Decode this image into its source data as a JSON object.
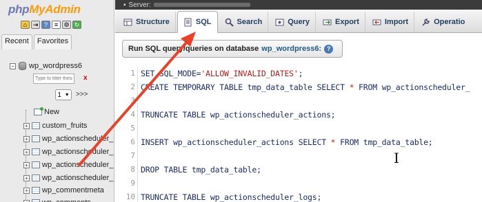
{
  "left_panel": {
    "logo_part1": "php",
    "logo_part2": "MyAdmin",
    "nav_tabs": [
      "Recent",
      "Favorites"
    ],
    "db_name": "wp_wordpress6",
    "filter_placeholder": "Type to filter these",
    "filter_clear": "x",
    "page_select_value": "1",
    "page_next": ">>>",
    "new_label": "New",
    "tables": [
      "custom_fruits",
      "wp_actionscheduler_",
      "wp_actionscheduler_",
      "wp_actionscheduler_",
      "wp_actionscheduler_",
      "wp_commentmeta",
      "wp_comments"
    ]
  },
  "server_bar": {
    "label": "Server:"
  },
  "tabs": [
    {
      "label": "Structure",
      "icon": "structure-icon"
    },
    {
      "label": "SQL",
      "icon": "sql-icon",
      "active": true
    },
    {
      "label": "Search",
      "icon": "search-icon"
    },
    {
      "label": "Query",
      "icon": "query-icon"
    },
    {
      "label": "Export",
      "icon": "export-icon"
    },
    {
      "label": "Import",
      "icon": "import-icon"
    },
    {
      "label": "Operatio",
      "icon": "wrench-icon"
    }
  ],
  "sql_panel": {
    "header_prefix": "Run SQL query/queries on database",
    "database": "wp_wordpress6:",
    "help_icon": "?"
  },
  "editor": {
    "lines": [
      {
        "n": "1",
        "text": "SET SQL_MODE=",
        "str": "'ALLOW_INVALID_DATES'",
        "tail": ";"
      },
      {
        "n": "2",
        "text": "CREATE TEMPORARY TABLE tmp_data_table SELECT ",
        "op": "*",
        "tail": " FROM wp_actionscheduler_"
      },
      {
        "n": "3",
        "text": ""
      },
      {
        "n": "4",
        "text": "TRUNCATE TABLE wp_actionscheduler_actions;"
      },
      {
        "n": "5",
        "text": ""
      },
      {
        "n": "6",
        "text": "INSERT wp_actionscheduler_actions SELECT ",
        "op": "*",
        "tail": " FROM tmp_data_table;"
      },
      {
        "n": "7",
        "text": ""
      },
      {
        "n": "8",
        "text": "DROP TABLE tmp_data_table;"
      },
      {
        "n": "9",
        "text": ""
      },
      {
        "n": "10",
        "text": "TRUNCATE TABLE wp_actionscheduler_logs;"
      }
    ]
  },
  "colors": {
    "arrow": "#e8432a",
    "accent": "#235a81"
  }
}
